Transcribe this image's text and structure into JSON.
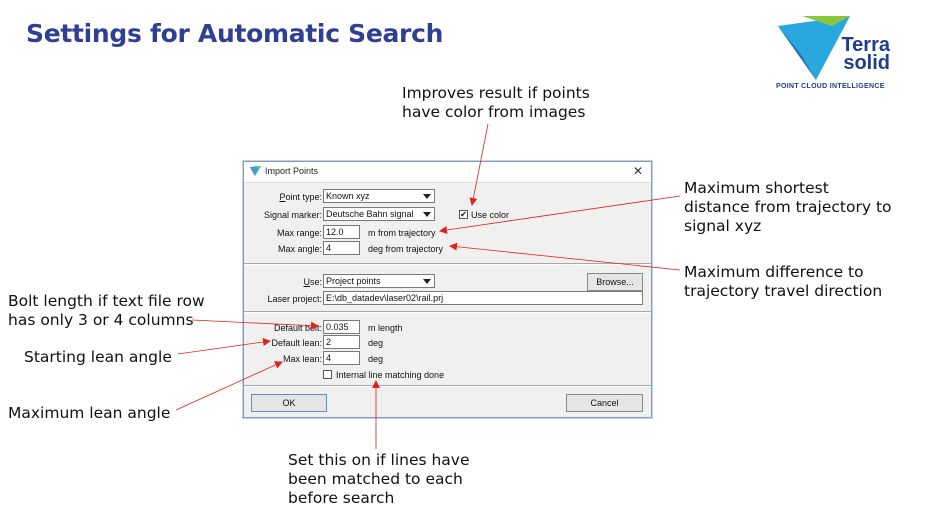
{
  "slide": {
    "title": "Settings for Automatic Search"
  },
  "logo": {
    "name_line1": "Terra",
    "name_line2": "solid",
    "tagline": "POINT CLOUD INTELLIGENCE"
  },
  "annotations": {
    "color": [
      "Improves result if points",
      "have color from images"
    ],
    "range": [
      "Maximum shortest",
      "distance from trajectory to",
      "signal xyz"
    ],
    "angle": [
      "Maximum difference to",
      "trajectory travel direction"
    ],
    "bolt": [
      "Bolt length if text file row",
      "has only 3 or 4 columns"
    ],
    "lean": [
      "Starting lean angle"
    ],
    "maxlean": [
      "Maximum lean angle"
    ],
    "matching": [
      "Set this on if lines have",
      "been matched to each",
      "before search"
    ]
  },
  "dialog": {
    "title": "Import Points",
    "close": "✕",
    "point_type": {
      "label_pre": "",
      "label_ul": "P",
      "label_post": "oint type:",
      "value": "Known xyz"
    },
    "signal_marker": {
      "label": "Signal marker:",
      "value": "Deutsche Bahn signal"
    },
    "use_color": {
      "label": "Use color",
      "checked": true,
      "mark": "✔"
    },
    "max_range": {
      "label": "Max range:",
      "value": "12.0",
      "unit": "m from trajectory"
    },
    "max_angle": {
      "label": "Max angle:",
      "value": "4",
      "unit": "deg from trajectory"
    },
    "use": {
      "label_ul": "U",
      "label_post": "se:",
      "value": "Project points"
    },
    "browse": "Browse...",
    "laser_project": {
      "label": "Laser project:",
      "value": "E:\\db_datadev\\laser02\\rail.prj"
    },
    "default_bolt": {
      "label": "Default bolt:",
      "value": "0.035",
      "unit": "m length"
    },
    "default_lean": {
      "label": "Default lean:",
      "value": "2",
      "unit": "deg"
    },
    "max_lean": {
      "label": "Max lean:",
      "value": "4",
      "unit": "deg"
    },
    "internal_matching": {
      "label": "Internal line matching done",
      "checked": false
    },
    "ok": "OK",
    "cancel": "Cancel"
  },
  "colors": {
    "title": "#2e3f94",
    "arrow": "#e2231a",
    "logo_blue": "#1f3d8f",
    "logo_cyan": "#29a8e0",
    "logo_green": "#8cc63f"
  }
}
